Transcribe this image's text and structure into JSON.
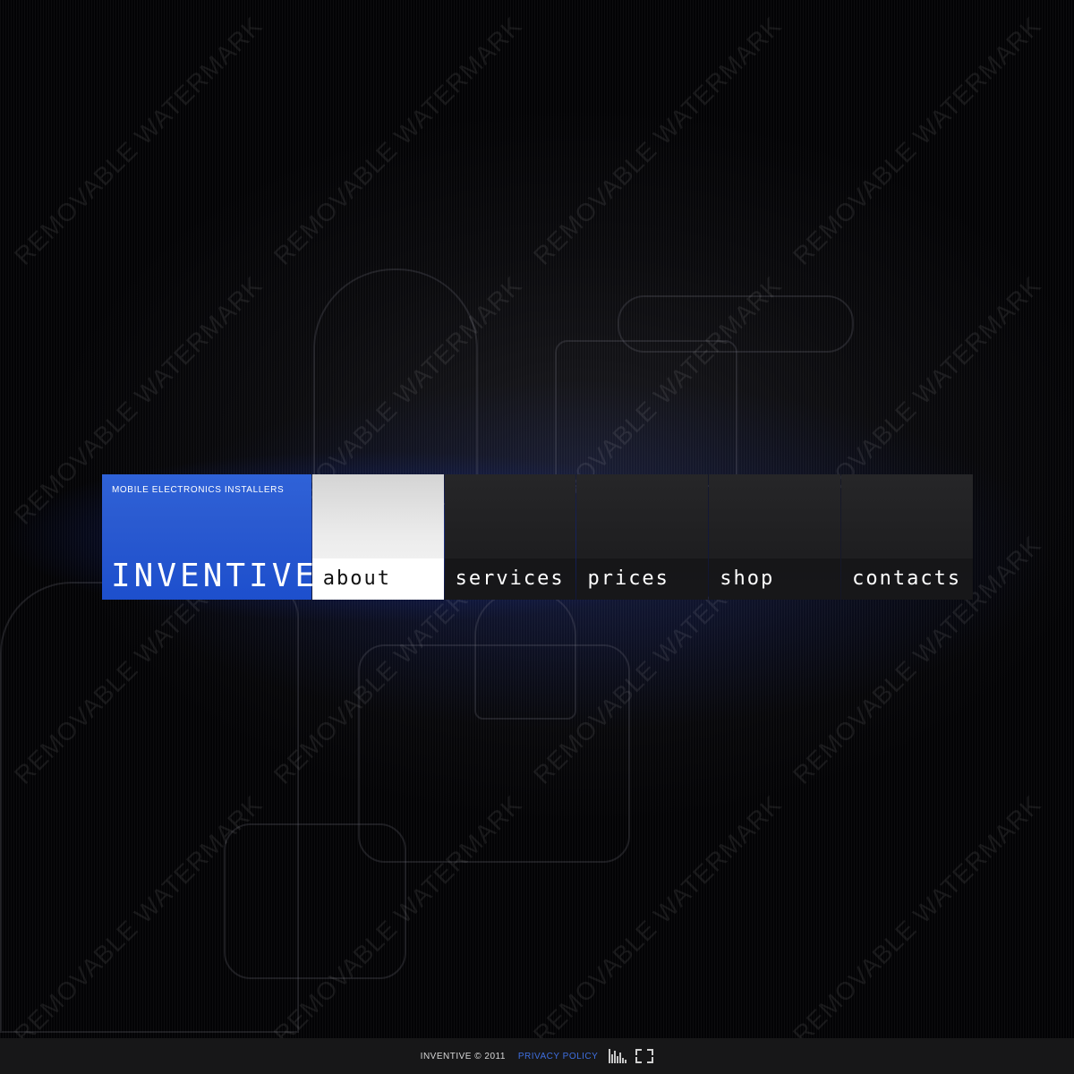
{
  "brand": {
    "tagline": "MOBILE ELECTRONICS INSTALLERS",
    "logo": "INVENTIVE",
    "accent_color": "#2a5ad0"
  },
  "menu": {
    "items": [
      {
        "label": "about",
        "active": true
      },
      {
        "label": "services",
        "active": false
      },
      {
        "label": "prices",
        "active": false
      },
      {
        "label": "shop",
        "active": false
      },
      {
        "label": "contacts",
        "active": false
      }
    ]
  },
  "footer": {
    "copyright": "INVENTIVE © 2011",
    "privacy_link": "PRIVACY POLICY",
    "link_color": "#3f6fe0",
    "icons": [
      "equalizer-icon",
      "fullscreen-icon"
    ]
  },
  "watermark": "REMOVABLE WATERMARK"
}
